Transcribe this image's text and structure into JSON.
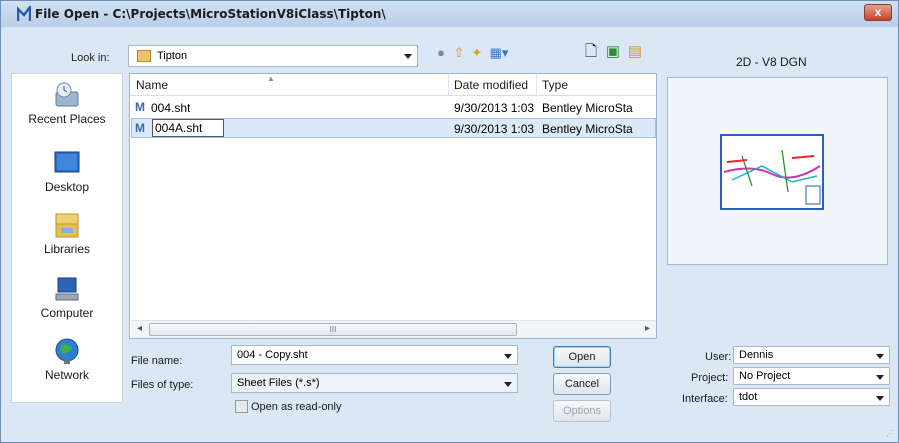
{
  "window": {
    "title": "File Open - C:\\Projects\\MicroStationV8iClass\\Tipton\\",
    "close_label": "x"
  },
  "look_in": {
    "label": "Look in:",
    "value": "Tipton"
  },
  "places": [
    {
      "label": "Recent Places",
      "icon": "recent-places-icon"
    },
    {
      "label": "Desktop",
      "icon": "desktop-icon"
    },
    {
      "label": "Libraries",
      "icon": "libraries-icon"
    },
    {
      "label": "Computer",
      "icon": "computer-icon"
    },
    {
      "label": "Network",
      "icon": "network-icon"
    }
  ],
  "file_list": {
    "columns": [
      "Name",
      "Date modified",
      "Type"
    ],
    "rows": [
      {
        "name": "004.sht",
        "date": "9/30/2013 1:03 ...",
        "type": "Bentley MicroSta"
      },
      {
        "name": "004A.sht",
        "date": "9/30/2013 1:03 ...",
        "type": "Bentley MicroSta",
        "selected": true
      }
    ],
    "scroll_grip": "III"
  },
  "file_name": {
    "label": "File name:",
    "value": "004 - Copy.sht"
  },
  "file_type": {
    "label": "Files of type:",
    "value": "Sheet Files (*.s*)"
  },
  "read_only": {
    "label": "Open as read-only",
    "checked": false
  },
  "buttons": {
    "open": "Open",
    "cancel": "Cancel",
    "options": "Options"
  },
  "preview": {
    "label": "2D - V8 DGN"
  },
  "workspace": {
    "user_label": "User:",
    "user_value": "Dennis",
    "project_label": "Project:",
    "project_value": "No Project",
    "interface_label": "Interface:",
    "interface_value": "tdot"
  },
  "colors": {
    "title_bar": "#c5d8ee",
    "selection": "#dce9f8",
    "close_button": "#c3442a",
    "preview_border": "#2a5fbf"
  }
}
